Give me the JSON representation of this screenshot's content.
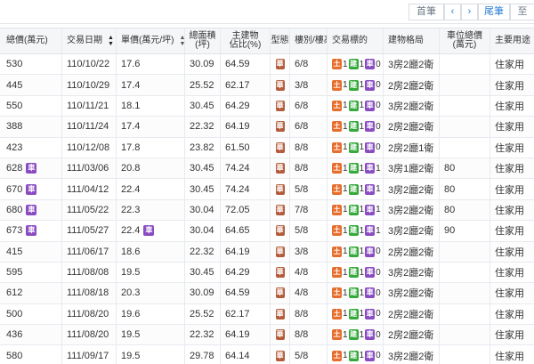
{
  "pager": {
    "first_label": "首筆",
    "prev_icon": "‹",
    "next_icon": "›",
    "last_label": "尾筆",
    "to_label": "至"
  },
  "headers": {
    "total_price": "總價(萬元)",
    "trade_date": "交易日期",
    "unit_price": "單價(萬元/坪)",
    "total_area_l1": "總面積",
    "total_area_l2": "(坪)",
    "main_ratio_l1": "主建物",
    "main_ratio_l2": "佔比(%)",
    "type": "型態",
    "floor": "樓別/樓高",
    "target": "交易標的",
    "layout": "建物格局",
    "parking_l1": "車位總價",
    "parking_l2": "(萬元)",
    "usage": "主要用途"
  },
  "labels": {
    "type_badge": "華",
    "land": "土",
    "building": "建",
    "car": "車"
  },
  "colors": {
    "land": "#e76d2c",
    "building": "#35a93b",
    "car": "#8a4cc2",
    "type": "#b35b3a"
  },
  "rows": [
    {
      "total": "530",
      "date": "110/10/22",
      "unit": "17.6",
      "area": "30.09",
      "ratio": "64.59",
      "floor": "6/8",
      "land": "1",
      "bld": "1",
      "car": "0",
      "layout": "3房2廳2衛",
      "parking": "",
      "usage": "住家用",
      "total_car": false,
      "unit_car": false
    },
    {
      "total": "445",
      "date": "110/10/29",
      "unit": "17.4",
      "area": "25.52",
      "ratio": "62.17",
      "floor": "3/8",
      "land": "1",
      "bld": "1",
      "car": "0",
      "layout": "2房2廳2衛",
      "parking": "",
      "usage": "住家用",
      "total_car": false,
      "unit_car": false
    },
    {
      "total": "550",
      "date": "110/11/21",
      "unit": "18.1",
      "area": "30.45",
      "ratio": "64.29",
      "floor": "6/8",
      "land": "1",
      "bld": "1",
      "car": "0",
      "layout": "3房2廳2衛",
      "parking": "",
      "usage": "住家用",
      "total_car": false,
      "unit_car": false
    },
    {
      "total": "388",
      "date": "110/11/24",
      "unit": "17.4",
      "area": "22.32",
      "ratio": "64.19",
      "floor": "6/8",
      "land": "1",
      "bld": "1",
      "car": "0",
      "layout": "2房2廳2衛",
      "parking": "",
      "usage": "住家用",
      "total_car": false,
      "unit_car": false
    },
    {
      "total": "423",
      "date": "110/12/08",
      "unit": "17.8",
      "area": "23.82",
      "ratio": "61.50",
      "floor": "8/8",
      "land": "1",
      "bld": "1",
      "car": "0",
      "layout": "2房2廳1衛",
      "parking": "",
      "usage": "住家用",
      "total_car": false,
      "unit_car": false
    },
    {
      "total": "628",
      "date": "111/03/06",
      "unit": "20.8",
      "area": "30.45",
      "ratio": "74.24",
      "floor": "8/8",
      "land": "1",
      "bld": "1",
      "car": "1",
      "layout": "3房1廳2衛",
      "parking": "80",
      "usage": "住家用",
      "total_car": true,
      "unit_car": false
    },
    {
      "total": "670",
      "date": "111/04/12",
      "unit": "22.4",
      "area": "30.45",
      "ratio": "74.24",
      "floor": "5/8",
      "land": "1",
      "bld": "1",
      "car": "1",
      "layout": "3房2廳2衛",
      "parking": "80",
      "usage": "住家用",
      "total_car": true,
      "unit_car": false
    },
    {
      "total": "680",
      "date": "111/05/22",
      "unit": "22.3",
      "area": "30.04",
      "ratio": "72.05",
      "floor": "7/8",
      "land": "1",
      "bld": "1",
      "car": "1",
      "layout": "3房2廳2衛",
      "parking": "80",
      "usage": "住家用",
      "total_car": true,
      "unit_car": false
    },
    {
      "total": "673",
      "date": "111/05/27",
      "unit": "22.4",
      "area": "30.04",
      "ratio": "64.65",
      "floor": "5/8",
      "land": "1",
      "bld": "1",
      "car": "1",
      "layout": "3房2廳2衛",
      "parking": "90",
      "usage": "住家用",
      "total_car": true,
      "unit_car": true
    },
    {
      "total": "415",
      "date": "111/06/17",
      "unit": "18.6",
      "area": "22.32",
      "ratio": "64.19",
      "floor": "3/8",
      "land": "1",
      "bld": "1",
      "car": "0",
      "layout": "2房2廳2衛",
      "parking": "",
      "usage": "住家用",
      "total_car": false,
      "unit_car": false
    },
    {
      "total": "595",
      "date": "111/08/08",
      "unit": "19.5",
      "area": "30.45",
      "ratio": "64.29",
      "floor": "4/8",
      "land": "1",
      "bld": "1",
      "car": "0",
      "layout": "3房2廳2衛",
      "parking": "",
      "usage": "住家用",
      "total_car": false,
      "unit_car": false
    },
    {
      "total": "612",
      "date": "111/08/18",
      "unit": "20.3",
      "area": "30.09",
      "ratio": "64.59",
      "floor": "4/8",
      "land": "1",
      "bld": "1",
      "car": "0",
      "layout": "3房2廳2衛",
      "parking": "",
      "usage": "住家用",
      "total_car": false,
      "unit_car": false
    },
    {
      "total": "500",
      "date": "111/08/20",
      "unit": "19.6",
      "area": "25.52",
      "ratio": "62.17",
      "floor": "8/8",
      "land": "1",
      "bld": "1",
      "car": "0",
      "layout": "2房2廳2衛",
      "parking": "",
      "usage": "住家用",
      "total_car": false,
      "unit_car": false
    },
    {
      "total": "436",
      "date": "111/08/20",
      "unit": "19.5",
      "area": "22.32",
      "ratio": "64.19",
      "floor": "8/8",
      "land": "1",
      "bld": "1",
      "car": "0",
      "layout": "2房2廳2衛",
      "parking": "",
      "usage": "住家用",
      "total_car": false,
      "unit_car": false
    },
    {
      "total": "580",
      "date": "111/09/17",
      "unit": "19.5",
      "area": "29.78",
      "ratio": "64.14",
      "floor": "5/8",
      "land": "1",
      "bld": "1",
      "car": "0",
      "layout": "3房2廳2衛",
      "parking": "",
      "usage": "住家用",
      "total_car": false,
      "unit_car": false
    }
  ]
}
